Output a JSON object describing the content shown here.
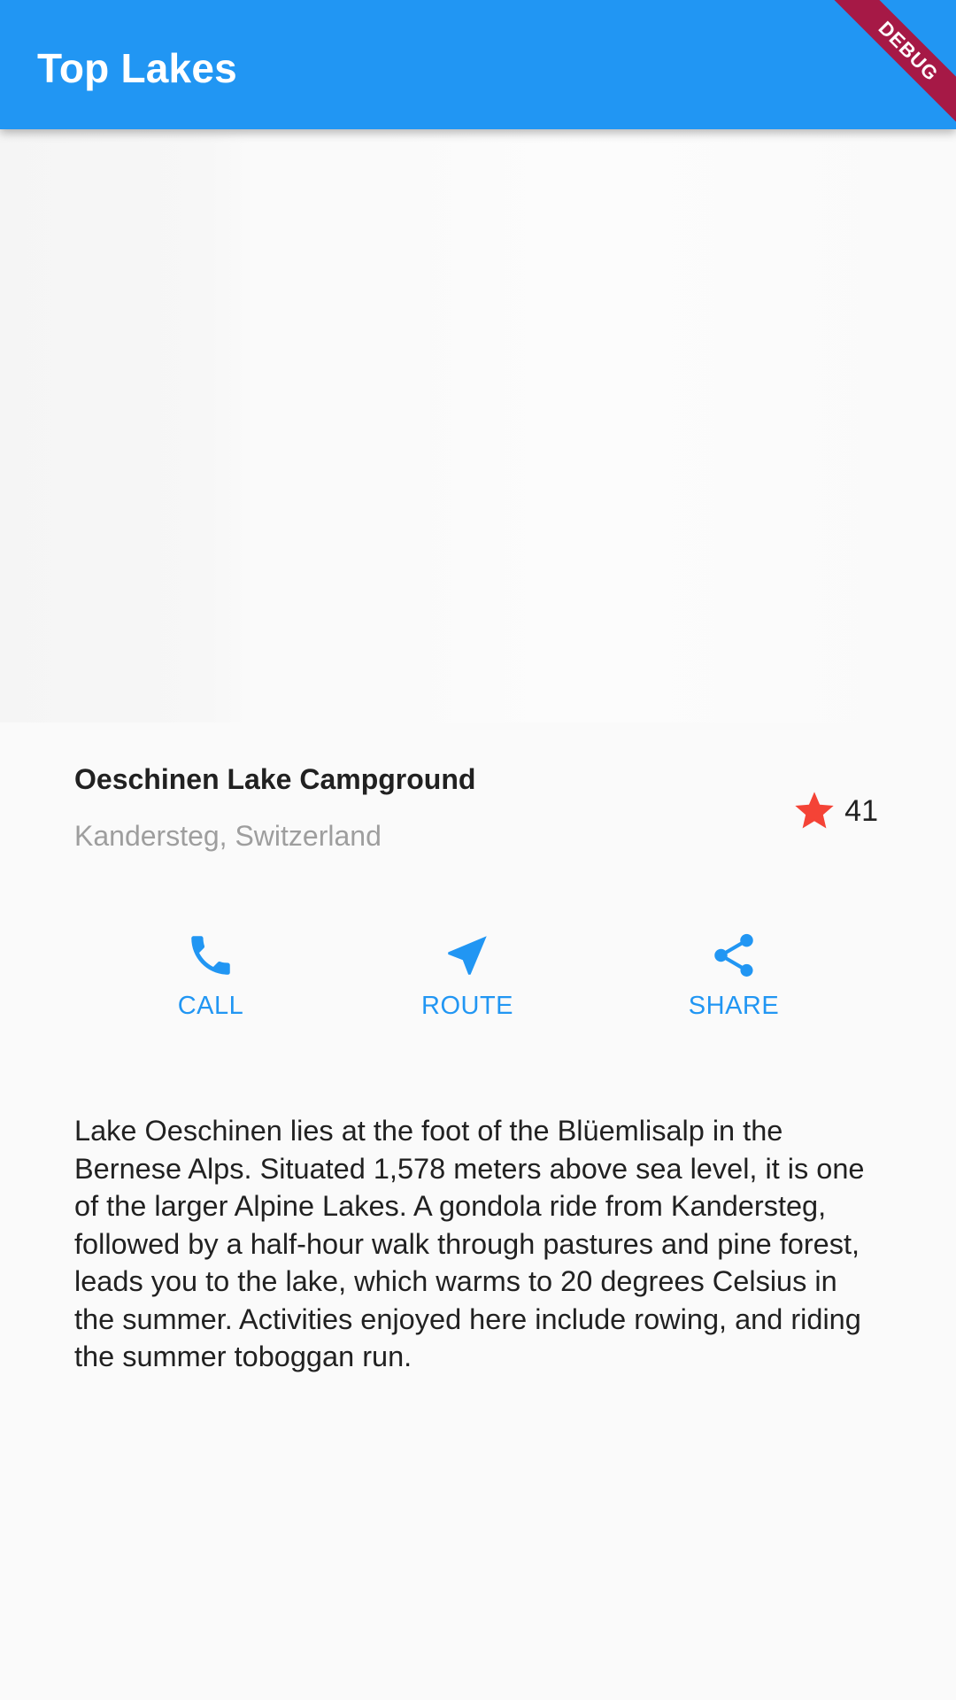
{
  "app_bar": {
    "title": "Top Lakes",
    "debug_label": "DEBUG"
  },
  "hero_image": {
    "icon": "lake-photo"
  },
  "place": {
    "name": "Oeschinen Lake Campground",
    "location": "Kandersteg, Switzerland",
    "rating_icon": "star-icon",
    "rating_count": "41"
  },
  "actions": [
    {
      "label": "CALL",
      "icon": "phone-icon"
    },
    {
      "label": "ROUTE",
      "icon": "navigation-icon"
    },
    {
      "label": "SHARE",
      "icon": "share-icon"
    }
  ],
  "description": "Lake Oeschinen lies at the foot of the Blüemlisalp in the Bernese Alps. Situated 1,578 meters above sea level, it is one of the larger Alpine Lakes. A gondola ride from Kandersteg, followed by a half-hour walk through pastures and pine forest, leads you to the lake, which warms to 20 degrees Celsius in the summer. Activities enjoyed here include rowing, and riding the summer toboggan run.",
  "colors": {
    "primary": "#2196f3",
    "star": "#f44336",
    "debug_banner": "#a61946",
    "secondary_text": "#9e9e9e"
  }
}
